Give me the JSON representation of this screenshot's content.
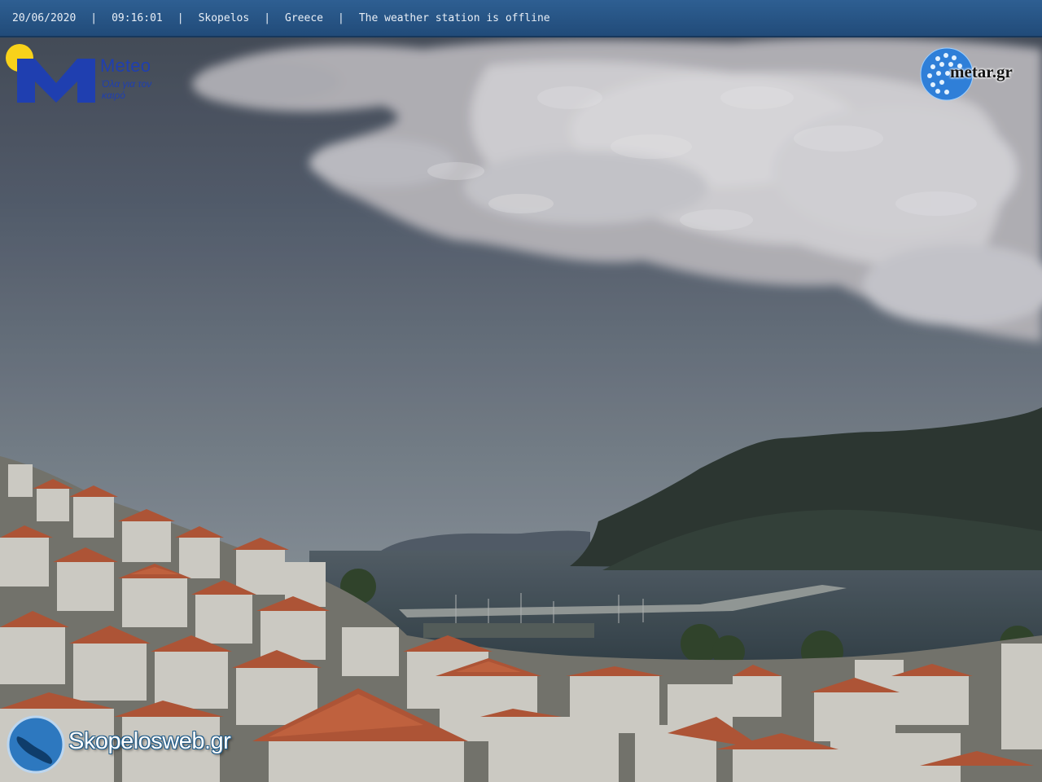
{
  "overlay": {
    "date": "20/06/2020",
    "time": "09:16:01",
    "location": "Skopelos",
    "country": "Greece",
    "station_status": "The weather station is offline",
    "separator": "|"
  },
  "logos": {
    "meteo": {
      "name": "Meteo",
      "tagline": "Όλα για τον καιρό"
    },
    "metar": {
      "name": "metar.gr"
    },
    "skopelosweb": {
      "name": "Skopelosweb.gr"
    }
  },
  "colors": {
    "bar_blue": "#2a5789",
    "meteo_blue": "#1f3fb0",
    "sun_yellow": "#f8d21a",
    "roof_terracotta": "#b85a3a"
  }
}
